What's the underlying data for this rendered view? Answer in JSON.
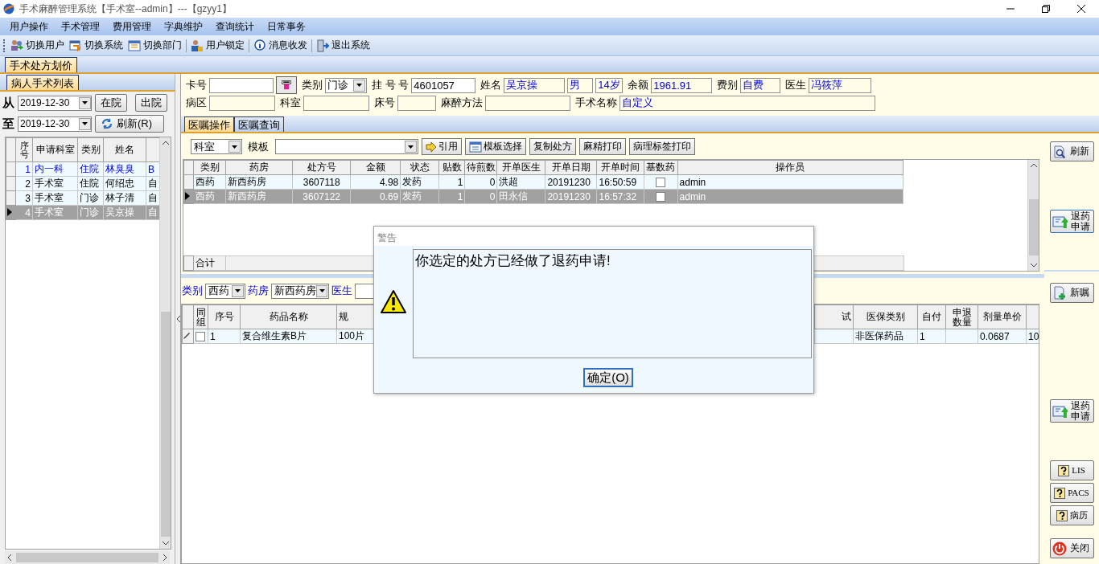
{
  "window": {
    "title": "手术麻醉管理系统【手术室--admin】---【gzyy1】"
  },
  "menu": [
    "用户操作",
    "手术管理",
    "费用管理",
    "字典维护",
    "查询统计",
    "日常事务"
  ],
  "toolbar": [
    {
      "kind": "users",
      "label": "切换用户"
    },
    {
      "kind": "switch",
      "label": "切换系统"
    },
    {
      "kind": "dept",
      "label": "切换部门"
    },
    {
      "kind": "lock",
      "label": "用户锁定"
    },
    {
      "kind": "info",
      "label": "消息收发"
    },
    {
      "kind": "exit",
      "label": "退出系统"
    }
  ],
  "main_tabs": [
    {
      "label": "手术处方划价",
      "selected": true
    }
  ],
  "patient_panel": {
    "tab": {
      "label": "病人手术列表",
      "selected": true
    },
    "from_label": "从",
    "from_date": "2019-12-30",
    "to_label": "至",
    "to_date": "2019-12-30",
    "buttons": [
      "在院",
      "出院"
    ],
    "refresh_button": "刷新(R)",
    "table": {
      "columns": [
        "序号",
        "申请科室",
        "类别",
        "姓名"
      ],
      "rows": [
        {
          "cells": [
            "1",
            "内一科",
            "住院",
            "林臭臭",
            "B"
          ],
          "highlighted": true,
          "selected": false
        },
        {
          "cells": [
            "2",
            "手术室",
            "住院",
            "何绍忠",
            "自"
          ],
          "highlighted": false,
          "selected": false
        },
        {
          "cells": [
            "3",
            "手术室",
            "门诊",
            "林子清",
            "自"
          ],
          "highlighted": false,
          "selected": false
        },
        {
          "cells": [
            "4",
            "手术室",
            "门诊",
            "吴京操",
            "自"
          ],
          "highlighted": false,
          "selected": true
        }
      ]
    }
  },
  "patient_form": [
    [
      {
        "kind": "input",
        "label": "卡号"
      },
      {
        "kind": "card_button"
      },
      {
        "kind": "select",
        "label": "类别",
        "value": "门诊"
      },
      {
        "kind": "input",
        "label": "挂 号 号",
        "value": "4601057"
      },
      {
        "kind": "info",
        "label": "姓名",
        "value": "吴京操"
      },
      {
        "kind": "info",
        "value": "男"
      },
      {
        "kind": "info",
        "value": "14岁"
      },
      {
        "kind": "info",
        "label": "余额",
        "value": "1961.91"
      },
      {
        "kind": "info",
        "label": "费别",
        "value": "自费"
      },
      {
        "kind": "info",
        "label": "医生",
        "value": "冯筱萍"
      }
    ],
    [
      {
        "kind": "info",
        "label": "病区"
      },
      {
        "kind": "info",
        "label": "科室"
      },
      {
        "kind": "info",
        "label": "床号"
      },
      {
        "kind": "info",
        "label": "麻醉方法"
      },
      {
        "kind": "info",
        "label": "手术名称",
        "value": "自定义"
      }
    ]
  ],
  "order_tabs": [
    {
      "label": "医嘱操作",
      "selected": true
    },
    {
      "label": "医嘱查询",
      "selected": false
    }
  ],
  "order_toolbar": {
    "dept_select": "科室",
    "template_label": "模板",
    "buttons": [
      {
        "kind": "quote",
        "label": "引用"
      },
      {
        "kind": "template",
        "label": "模板选择"
      },
      {
        "kind": "plain",
        "label": "复制处方"
      },
      {
        "kind": "plain",
        "label": "麻精打印"
      },
      {
        "kind": "plain",
        "label": "病理标签打印"
      }
    ]
  },
  "prescriptions": {
    "columns": [
      "类别",
      "药房",
      "处方号",
      "金额",
      "状态",
      "贴数",
      "待煎数",
      "开单医生",
      "开单日期",
      "开单时间",
      "基数药",
      "操作员"
    ],
    "rows": [
      {
        "cells": [
          "西药",
          "新西药房",
          "3607118",
          "4.98",
          "发药",
          "1",
          "0",
          "洪超",
          "20191230",
          "16:50:59"
        ],
        "base_drug": false,
        "operator": "admin",
        "selected": false
      },
      {
        "cells": [
          "西药",
          "新西药房",
          "3607122",
          "0.69",
          "发药",
          "1",
          "0",
          "田永信",
          "20191230",
          "16:57:32"
        ],
        "base_drug": false,
        "operator": "admin",
        "selected": true
      }
    ],
    "total_label": "合计"
  },
  "drug_filter": {
    "type_label": "类别",
    "type_value": "西药",
    "pharmacy_label": "药房",
    "pharmacy_value": "新西药房",
    "doctor_label": "医生"
  },
  "drugs": {
    "columns": [
      "同组",
      "序号",
      "药品名称",
      "规",
      "试",
      "医保类别",
      "自付",
      "申退数量",
      "剂量单价"
    ],
    "rows": [
      {
        "grouped": false,
        "cells": [
          "",
          "1",
          "复合维生素B片",
          "100片",
          "",
          "非医保药品",
          "1",
          "",
          "0.0687",
          "10"
        ]
      }
    ]
  },
  "side_buttons_top": [
    {
      "kind": "refresh",
      "label": "刷新"
    },
    {
      "kind": "refund",
      "label": "退药申请"
    }
  ],
  "side_buttons_bottom": [
    {
      "kind": "new",
      "label": "新嘱"
    },
    {
      "kind": "refund",
      "label": "退药申请"
    },
    {
      "kind": "help",
      "label": "LIS"
    },
    {
      "kind": "help",
      "label": "PACS"
    },
    {
      "kind": "help",
      "label": "病历"
    },
    {
      "kind": "power",
      "label": "关闭"
    }
  ],
  "dialog": {
    "title": "警告",
    "message": "你选定的处方已经做了退药申请!",
    "button": "确定(O)"
  }
}
